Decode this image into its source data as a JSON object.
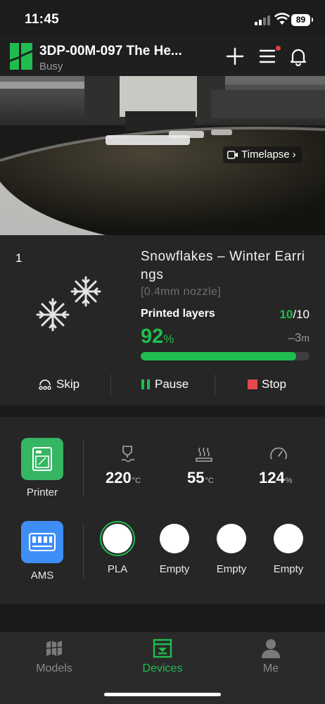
{
  "status_bar": {
    "time": "11:45",
    "battery": "89"
  },
  "header": {
    "title": "3DP-00M-097 The He...",
    "status": "Busy",
    "icons": [
      "bambu-logo-icon",
      "plus-icon",
      "menu-icon",
      "bell-icon"
    ],
    "notification_dot": true
  },
  "camera": {
    "timelapse_label": "Timelapse"
  },
  "job": {
    "plate_number": "1",
    "title": "Snowflakes – Winter Earrings",
    "nozzle": "[0.4mm nozzle]",
    "layers_label": "Printed layers",
    "layers_current": "10",
    "layers_total": "/10",
    "progress_value": "92",
    "progress_unit": "%",
    "progress_fraction": 0.92,
    "remaining_value": "–3",
    "remaining_unit": "m",
    "actions": {
      "skip": "Skip",
      "pause": "Pause",
      "stop": "Stop"
    }
  },
  "device": {
    "printer_label": "Printer",
    "ams_label": "AMS",
    "nozzle_temp": "220",
    "bed_temp": "55",
    "temp_unit": "°C",
    "speed": "124",
    "speed_unit": "%",
    "slots": [
      "PLA",
      "Empty",
      "Empty",
      "Empty"
    ]
  },
  "tabs": {
    "models": "Models",
    "devices": "Devices",
    "me": "Me",
    "active": "devices"
  },
  "colors": {
    "accent": "#1fbd4f",
    "stop": "#e5484d",
    "ams": "#3f8ef5",
    "printer": "#36b563"
  }
}
